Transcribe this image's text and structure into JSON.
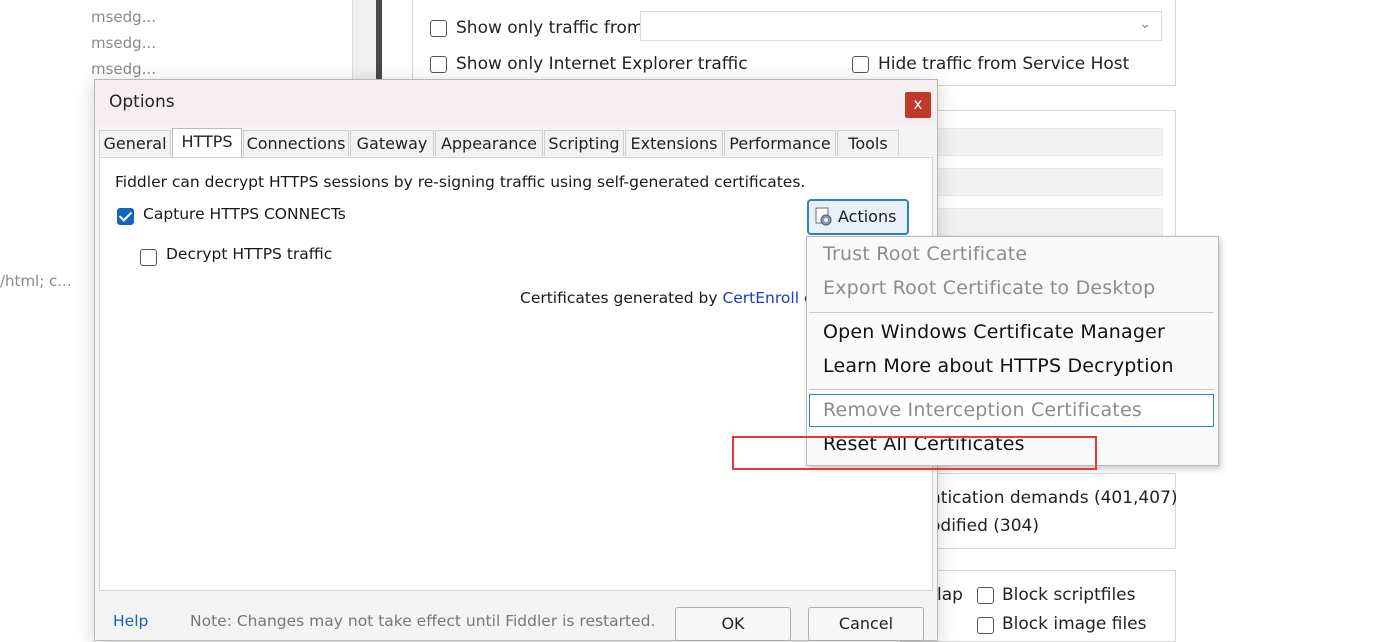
{
  "background": {
    "sessions": [
      "msedg...",
      "msedg...",
      "msedg..."
    ],
    "content_type_snippet": "/html; c...",
    "client_process": {
      "show_only_traffic_from_label": "Show only traffic from",
      "show_only_ie_label": "Show only Internet Explorer traffic",
      "hide_service_host_label": "Hide traffic from Service Host"
    },
    "breakpoints": {
      "auth_demands_label": "ntication demands (401,407)",
      "not_modified_label": "odified (304)"
    },
    "blocking": {
      "flap_label": "lap",
      "block_script_label": "Block scriptfiles",
      "block_image_label": "Block image files"
    }
  },
  "dialog": {
    "title": "Options",
    "close_label": "x",
    "tabs": [
      {
        "label": "General"
      },
      {
        "label": "HTTPS"
      },
      {
        "label": "Connections"
      },
      {
        "label": "Gateway"
      },
      {
        "label": "Appearance"
      },
      {
        "label": "Scripting"
      },
      {
        "label": "Extensions"
      },
      {
        "label": "Performance"
      },
      {
        "label": "Tools"
      }
    ],
    "active_tab": "HTTPS",
    "https": {
      "description": "Fiddler can decrypt HTTPS sessions by re-signing traffic using self-generated certificates.",
      "capture_label": "Capture HTTPS CONNECTs",
      "capture_checked": true,
      "decrypt_label": "Decrypt HTTPS traffic",
      "decrypt_checked": false,
      "cert_prefix": "Certificates generated by ",
      "cert_link": "CertEnroll e",
      "actions_label": "Actions"
    },
    "footer": {
      "help_label": "Help",
      "note": "Note: Changes may not take effect until Fiddler is restarted.",
      "ok_label": "OK",
      "cancel_label": "Cancel"
    }
  },
  "actions_menu": {
    "items": [
      {
        "label": "Trust Root Certificate",
        "enabled": false
      },
      {
        "label": "Export Root Certificate to Desktop",
        "enabled": false
      },
      {
        "label": "Open Windows Certificate Manager",
        "enabled": true
      },
      {
        "label": "Learn More about HTTPS Decryption",
        "enabled": true
      },
      {
        "label": "Remove Interception Certificates",
        "enabled": false,
        "highlighted": true
      },
      {
        "label": "Reset All Certificates",
        "enabled": true
      }
    ]
  },
  "colors": {
    "accent": "#2f7fd1",
    "checkbox_checked": "#1565c0",
    "close_button": "#c0392b",
    "annotation_red": "#e53935",
    "link": "#1a3dba"
  }
}
